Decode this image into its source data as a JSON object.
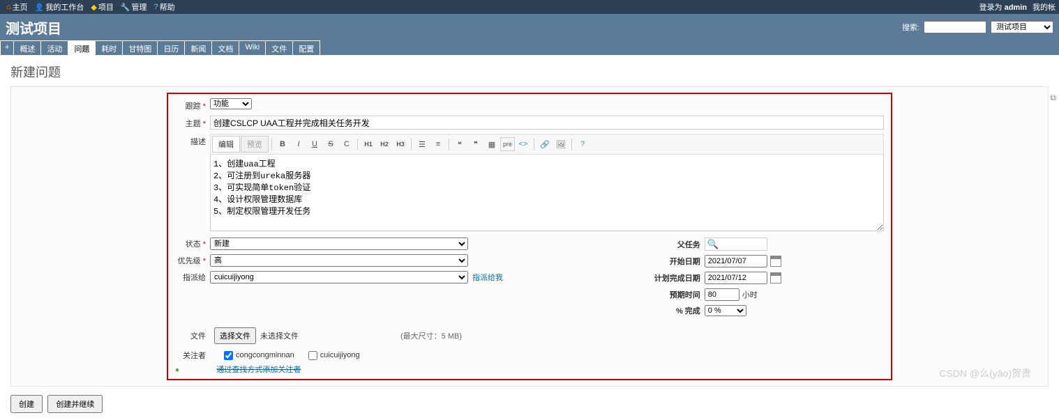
{
  "topNav": {
    "home": "主页",
    "myPage": "我的工作台",
    "projects": "项目",
    "admin": "管理",
    "help": "帮助"
  },
  "loginInfo": {
    "loggedAs": "登录为",
    "user": "admin",
    "myAccount": "我的帐"
  },
  "header": {
    "title": "测试项目",
    "searchLabel": "搜索:",
    "projectPlaceholder": "测试项目"
  },
  "tabs": {
    "plus": "+",
    "overview": "概述",
    "activity": "活动",
    "issues": "问题",
    "spentTime": "耗时",
    "gantt": "甘特图",
    "calendar": "日历",
    "news": "新闻",
    "documents": "文档",
    "wiki": "Wiki",
    "files": "文件",
    "settings": "配置"
  },
  "pageTitle": "新建问题",
  "form": {
    "trackerLabel": "跟踪",
    "trackerValue": "功能",
    "subjectLabel": "主题",
    "subjectValue": "创建CSLCP UAA工程并完成相关任务开发",
    "descLabel": "描述",
    "editTab": "编辑",
    "previewTab": "预览",
    "descValue": "1、创建uaa工程\n2、可注册到ureka服务器\n3、可实现简单token验证\n4、设计权限管理数据库\n5、制定权限管理开发任务",
    "statusLabel": "状态",
    "statusValue": "新建",
    "priorityLabel": "优先级",
    "priorityValue": "高",
    "assigneeLabel": "指派给",
    "assigneeValue": "cuicuijiyong",
    "assignToMe": "指派给我",
    "parentLabel": "父任务",
    "startLabel": "开始日期",
    "startValue": "2021/07/07",
    "dueLabel": "计划完成日期",
    "dueValue": "2021/07/12",
    "estimatedLabel": "预期时间",
    "estimatedValue": "80",
    "hoursUnit": "小时",
    "doneLabel": "% 完成",
    "doneValue": "0 %",
    "filesLabel": "文件",
    "chooseFile": "选择文件",
    "noFile": "未选择文件",
    "maxSize": "(最大尺寸：5 MB)",
    "watchersLabel": "关注者",
    "watcher1": "congcongminnan",
    "watcher2": "cuicuijiyong",
    "searchAdd": "通过查找方式添加关注者"
  },
  "toolbar": {
    "bold": "B",
    "italic": "I",
    "underline": "U",
    "strike": "S",
    "code": "C",
    "h1": "H1",
    "h2": "H2",
    "h3": "H3",
    "pre": "pre",
    "codeTag": "<>"
  },
  "buttons": {
    "create": "创建",
    "createContinue": "创建并继续"
  },
  "watermark": "CSDN @么(yāo)贺贵"
}
